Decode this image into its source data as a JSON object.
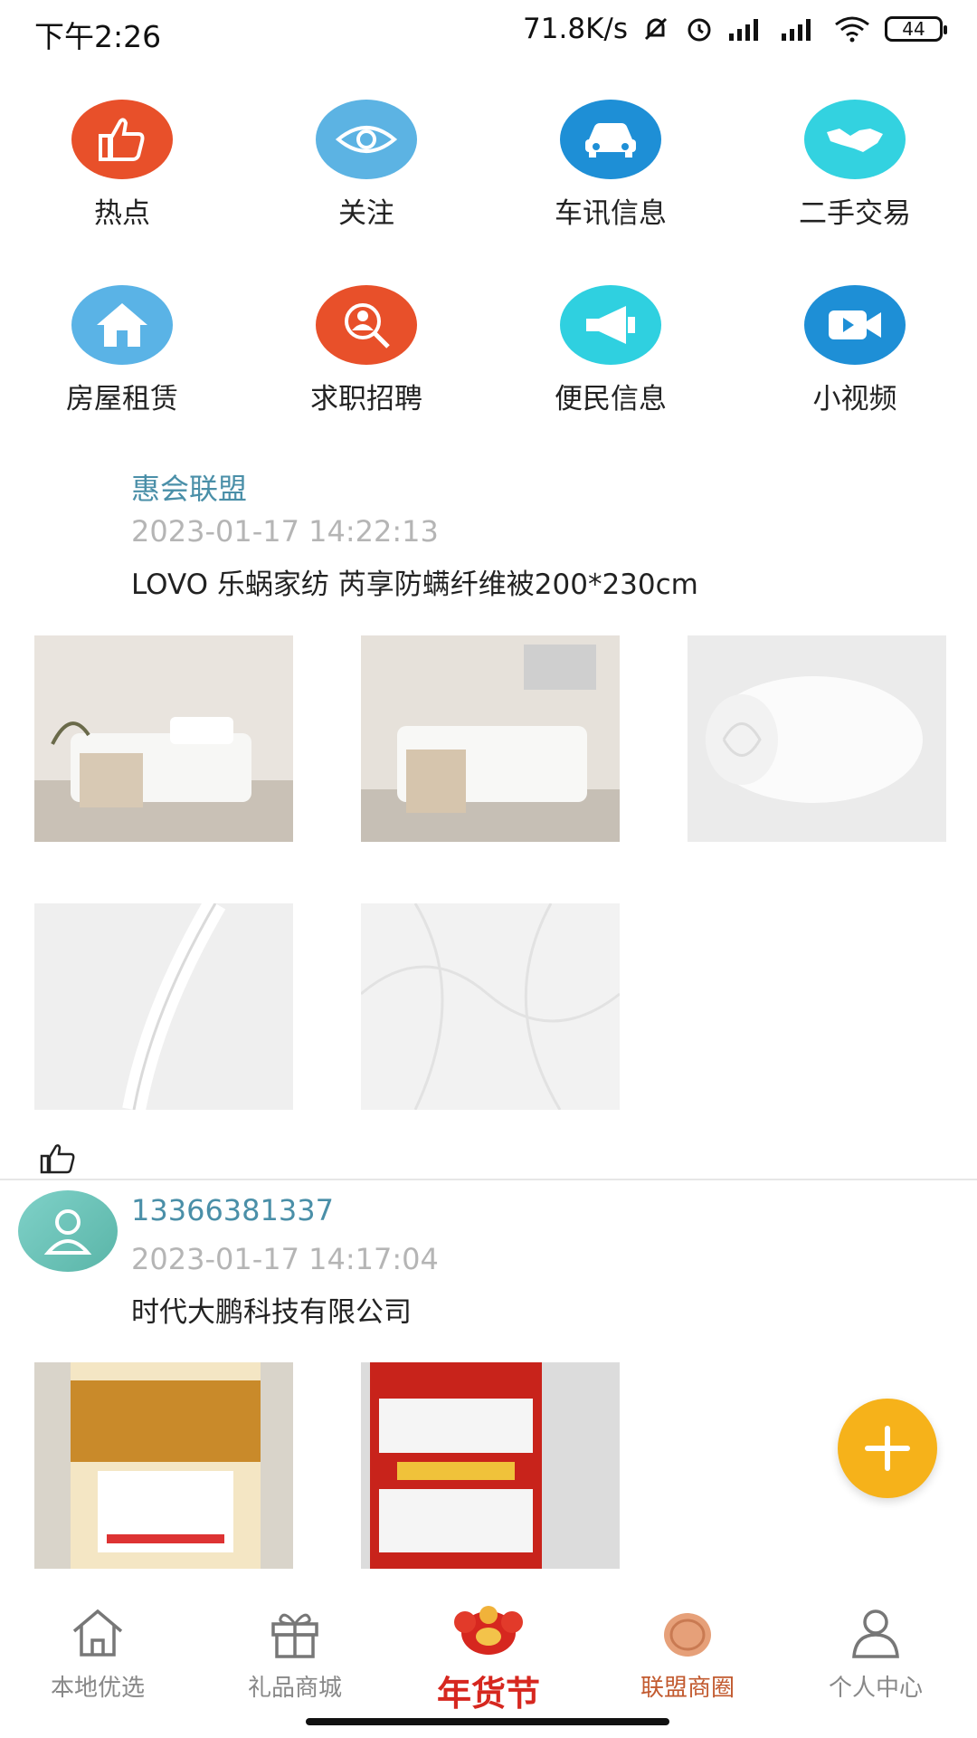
{
  "status_bar": {
    "time": "下午2:26",
    "net_speed": "71.8K/s",
    "battery": "44"
  },
  "categories": [
    {
      "label": "热点",
      "icon": "thumbs-up-icon",
      "color": "#e8502a"
    },
    {
      "label": "关注",
      "icon": "eye-icon",
      "color": "#5cb3e3"
    },
    {
      "label": "车讯信息",
      "icon": "car-icon",
      "color": "#1e8fd6"
    },
    {
      "label": "二手交易",
      "icon": "handshake-icon",
      "color": "#33d2e0"
    },
    {
      "label": "房屋租赁",
      "icon": "house-icon",
      "color": "#5ab3e6"
    },
    {
      "label": "求职招聘",
      "icon": "job-search-icon",
      "color": "#e8502a"
    },
    {
      "label": "便民信息",
      "icon": "megaphone-icon",
      "color": "#2fd0e0"
    },
    {
      "label": "小视频",
      "icon": "video-camera-icon",
      "color": "#1e8fd6"
    }
  ],
  "posts": [
    {
      "author": "惠会联盟",
      "time": "2023-01-17 14:22:13",
      "title": "LOVO 乐蜗家纺 芮享防螨纤维被200*230cm"
    },
    {
      "author": "13366381337",
      "time": "2023-01-17 14:17:04",
      "title": "时代大鹏科技有限公司"
    }
  ],
  "bottom_nav": {
    "items": [
      {
        "label": "本地优选",
        "icon": "home-icon"
      },
      {
        "label": "礼品商城",
        "icon": "gift-icon"
      },
      {
        "label": "联盟商圈",
        "icon": "circle-plate-icon"
      },
      {
        "label": "个人中心",
        "icon": "user-icon"
      }
    ],
    "festival_label": "年货节"
  },
  "colors": {
    "accent": "#4a8fa8",
    "fab": "#f6b21a",
    "festival": "#d6271f",
    "active_nav": "#c25a2f"
  }
}
